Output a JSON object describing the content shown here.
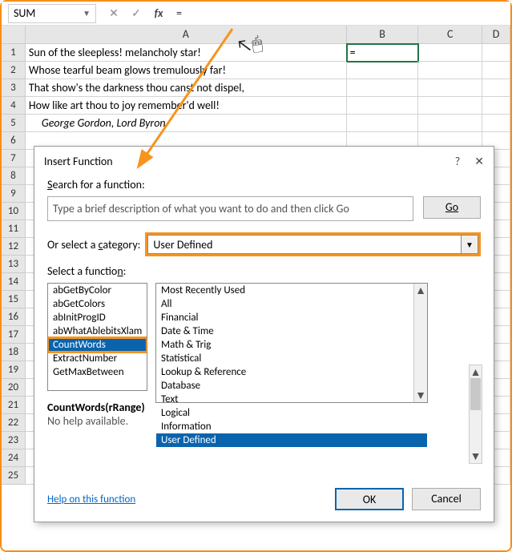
{
  "formula_bar": {
    "name_box": "SUM",
    "formula": "="
  },
  "columns": [
    "A",
    "B",
    "C",
    "D"
  ],
  "rows": [
    {
      "n": "1",
      "a": "Sun of the sleepless! melancholy star!",
      "b": "=",
      "sel": true
    },
    {
      "n": "2",
      "a": "Whose tearful beam glows tremulously far!"
    },
    {
      "n": "3",
      "a": "That show's the darkness thou canst not dispel,"
    },
    {
      "n": "4",
      "a": "How like art thou to joy remember'd well!"
    },
    {
      "n": "5",
      "a": "George Gordon, Lord Byron",
      "ital": true
    },
    {
      "n": "6"
    },
    {
      "n": "7"
    },
    {
      "n": "8"
    },
    {
      "n": "9"
    },
    {
      "n": "10"
    },
    {
      "n": "11"
    },
    {
      "n": "12"
    },
    {
      "n": "13"
    },
    {
      "n": "14"
    },
    {
      "n": "15"
    },
    {
      "n": "16"
    },
    {
      "n": "17"
    },
    {
      "n": "18"
    },
    {
      "n": "19"
    },
    {
      "n": "20"
    },
    {
      "n": "21"
    },
    {
      "n": "22"
    },
    {
      "n": "23"
    },
    {
      "n": "24"
    },
    {
      "n": "25"
    }
  ],
  "dialog": {
    "title": "Insert Function",
    "search_label": "Search for a function:",
    "search_placeholder": "Type a brief description of what you want to do and then click Go",
    "go": "Go",
    "category_label": "Or select a category:",
    "category_value": "User Defined",
    "select_label": "Select a function:",
    "functions": [
      "abGetByColor",
      "abGetColors",
      "abInitProgID",
      "abWhatAblebitsXlam",
      "CountWords",
      "ExtractNumber",
      "GetMaxBetween"
    ],
    "selected_function": "CountWords",
    "categories": [
      "Most Recently Used",
      "All",
      "Financial",
      "Date & Time",
      "Math & Trig",
      "Statistical",
      "Lookup & Reference",
      "Database",
      "Text",
      "Logical",
      "Information",
      "User Defined"
    ],
    "selected_category": "User Defined",
    "syntax": "CountWords(rRange)",
    "help_text": "No help available.",
    "help_link": "Help on this function",
    "ok": "OK",
    "cancel": "Cancel"
  }
}
